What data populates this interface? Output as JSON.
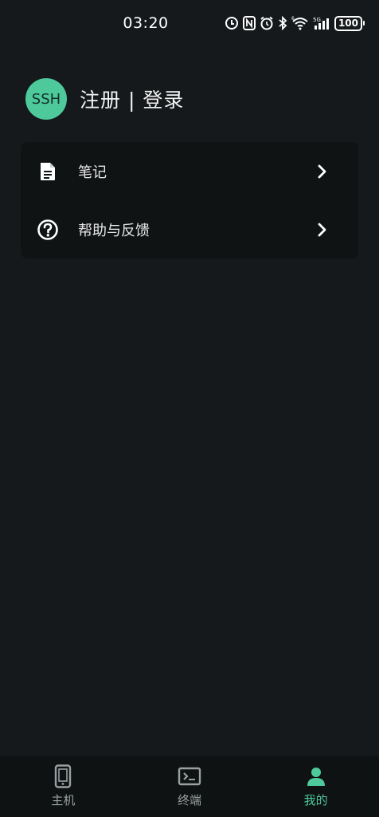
{
  "status_bar": {
    "time": "03:20",
    "battery": "100",
    "network": "5G",
    "icons": [
      "data-saver-icon",
      "nfc-icon",
      "alarm-icon",
      "bluetooth-icon",
      "wifi-icon",
      "signal-icon",
      "battery-icon"
    ]
  },
  "profile": {
    "avatar_text": "SSH",
    "login_text": "注册 | 登录"
  },
  "menu": {
    "items": [
      {
        "label": "笔记",
        "icon": "document-icon"
      },
      {
        "label": "帮助与反馈",
        "icon": "help-circle-icon"
      }
    ]
  },
  "bottom_nav": {
    "tabs": [
      {
        "label": "主机",
        "icon": "phone-device-icon",
        "active": false
      },
      {
        "label": "终端",
        "icon": "terminal-icon",
        "active": false
      },
      {
        "label": "我的",
        "icon": "person-icon",
        "active": true
      }
    ]
  },
  "colors": {
    "background": "#15191b",
    "card": "#101314",
    "accent": "#4ec99b",
    "nav_inactive": "#9aa0a2"
  }
}
